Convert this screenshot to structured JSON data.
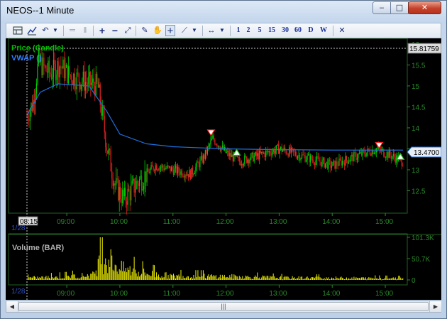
{
  "window": {
    "title": "NEOS--1 Minute",
    "minimize_glyph": "‒",
    "maximize_glyph": "□",
    "close_glyph": "✕"
  },
  "toolbar": {
    "timeframes": [
      "1",
      "2",
      "5",
      "15",
      "30",
      "60",
      "D",
      "W"
    ],
    "icons": [
      "layout-icon",
      "chart-type-icon",
      "undo-icon",
      "dropdown-icon",
      "add-pane-icon",
      "split-pane-icon",
      "zoom-in-icon",
      "zoom-out-icon",
      "zoom-fit-icon",
      "pencil-icon",
      "pan-hand-icon",
      "crosshair-icon",
      "trendline-icon",
      "trendline-dropdown-icon",
      "range-arrows-icon",
      "range-dropdown-icon",
      "close-chart-icon"
    ]
  },
  "price_panel": {
    "legend_price": "Price (Candle)",
    "legend_vwap": "VWAP ()",
    "y_ticks": [
      "16",
      "15.5",
      "15",
      "14.5",
      "14",
      "13.5",
      "13",
      "12.5"
    ],
    "last_price_tag": "15.81759",
    "vwap_tag": "13.4700",
    "crosshair_time_label": "08:15",
    "date_label": "1/28"
  },
  "volume_panel": {
    "legend": "Volume (BAR)",
    "y_ticks": [
      "101.3K",
      "50.7K",
      "0"
    ],
    "date_label": "1/28"
  },
  "time_axis": [
    "09:00",
    "10:00",
    "11:00",
    "12:00",
    "13:00",
    "14:00",
    "15:00"
  ],
  "colors": {
    "up_candle": "#00d000",
    "down_candle": "#e02020",
    "vwap": "#1f6fe0",
    "volume": "#f0f000",
    "axis_text": "#2a8a2a",
    "legend_price": "#00c000",
    "legend_vwap": "#2f7fff",
    "volume_legend": "#b0b0b0"
  },
  "chart_data": {
    "type": "candlestick",
    "x_range": [
      "08:15",
      "15:20"
    ],
    "price_ylim": [
      12.0,
      16.1
    ],
    "vwap": [
      {
        "t": "08:15",
        "v": 14.3
      },
      {
        "t": "08:30",
        "v": 14.85
      },
      {
        "t": "08:50",
        "v": 15.05
      },
      {
        "t": "09:25",
        "v": 15.0
      },
      {
        "t": "09:45",
        "v": 14.4
      },
      {
        "t": "10:00",
        "v": 13.85
      },
      {
        "t": "10:30",
        "v": 13.62
      },
      {
        "t": "11:00",
        "v": 13.55
      },
      {
        "t": "12:00",
        "v": 13.5
      },
      {
        "t": "13:00",
        "v": 13.48
      },
      {
        "t": "14:00",
        "v": 13.47
      },
      {
        "t": "15:20",
        "v": 13.47
      }
    ],
    "price_path": [
      {
        "t": "08:15",
        "v": 14.3
      },
      {
        "t": "08:22",
        "v": 14.6
      },
      {
        "t": "08:28",
        "v": 15.6
      },
      {
        "t": "08:35",
        "v": 15.4
      },
      {
        "t": "08:42",
        "v": 15.3
      },
      {
        "t": "08:52",
        "v": 15.5
      },
      {
        "t": "09:00",
        "v": 15.3
      },
      {
        "t": "09:20",
        "v": 15.1
      },
      {
        "t": "09:35",
        "v": 15.0
      },
      {
        "t": "09:45",
        "v": 13.6
      },
      {
        "t": "09:55",
        "v": 12.6
      },
      {
        "t": "10:05",
        "v": 12.3
      },
      {
        "t": "10:20",
        "v": 12.7
      },
      {
        "t": "10:40",
        "v": 13.1
      },
      {
        "t": "11:00",
        "v": 13.0
      },
      {
        "t": "11:20",
        "v": 12.9
      },
      {
        "t": "11:35",
        "v": 13.3
      },
      {
        "t": "11:45",
        "v": 13.75
      },
      {
        "t": "12:00",
        "v": 13.4
      },
      {
        "t": "12:15",
        "v": 13.2
      },
      {
        "t": "12:30",
        "v": 13.3
      },
      {
        "t": "13:00",
        "v": 13.5
      },
      {
        "t": "13:30",
        "v": 13.3
      },
      {
        "t": "14:00",
        "v": 13.1
      },
      {
        "t": "14:30",
        "v": 13.35
      },
      {
        "t": "14:50",
        "v": 13.5
      },
      {
        "t": "15:10",
        "v": 13.3
      },
      {
        "t": "15:20",
        "v": 13.2
      }
    ],
    "signals": [
      {
        "t": "11:43",
        "type": "sell",
        "v": 13.85
      },
      {
        "t": "12:12",
        "type": "buy",
        "v": 13.45
      },
      {
        "t": "14:53",
        "type": "sell",
        "v": 13.55
      },
      {
        "t": "15:17",
        "type": "buy",
        "v": 13.35
      }
    ],
    "volume_ylim": [
      0,
      101300
    ],
    "volume_profile": [
      {
        "t": "08:15",
        "v": 8000
      },
      {
        "t": "09:00",
        "v": 12000
      },
      {
        "t": "09:30",
        "v": 20000
      },
      {
        "t": "09:40",
        "v": 90000
      },
      {
        "t": "09:50",
        "v": 75000
      },
      {
        "t": "10:00",
        "v": 45000
      },
      {
        "t": "10:30",
        "v": 25000
      },
      {
        "t": "11:00",
        "v": 15000
      },
      {
        "t": "12:00",
        "v": 14000
      },
      {
        "t": "13:00",
        "v": 9000
      },
      {
        "t": "14:00",
        "v": 8000
      },
      {
        "t": "15:20",
        "v": 6000
      }
    ]
  }
}
